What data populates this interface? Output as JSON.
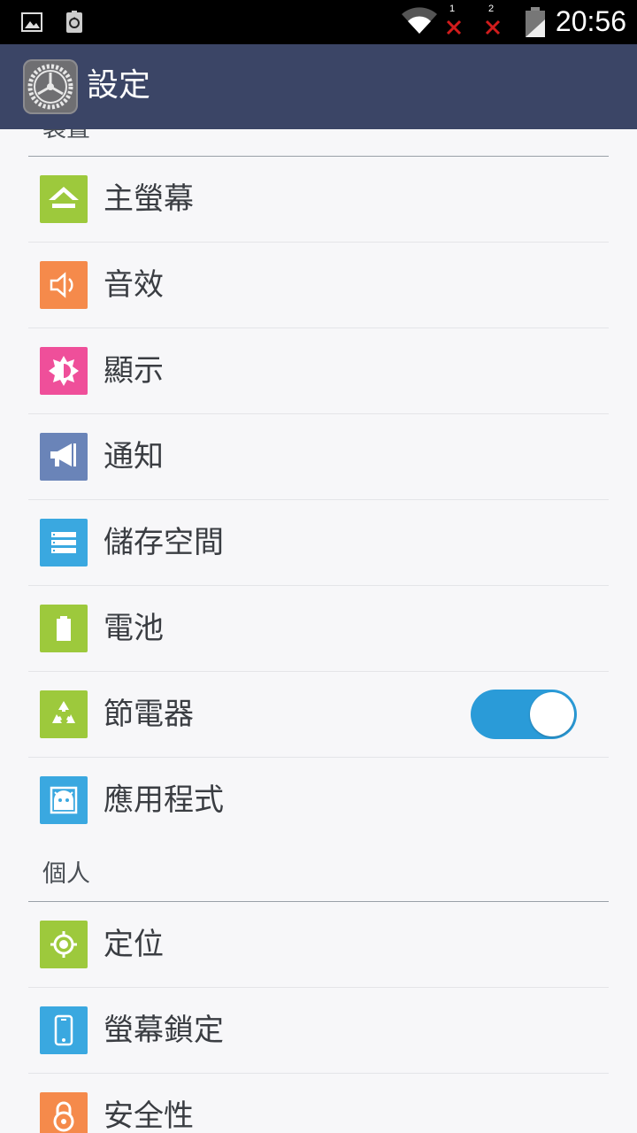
{
  "status_bar": {
    "time": "20:56",
    "sim1_label": "1",
    "sim2_label": "2",
    "icons": [
      "image-icon",
      "recycle-notification-icon",
      "wifi-icon",
      "no-signal-sim1-icon",
      "no-signal-sim2-icon",
      "battery-charging-icon"
    ]
  },
  "app_bar": {
    "title": "設定",
    "icon": "settings-gear-icon"
  },
  "sections": {
    "device": {
      "header": "裝置",
      "items": {
        "home": {
          "label": "主螢幕",
          "icon": "home-icon",
          "color": "#9dc93c"
        },
        "sound": {
          "label": "音效",
          "icon": "speaker-icon",
          "color": "#f58a4b"
        },
        "display": {
          "label": "顯示",
          "icon": "brightness-icon",
          "color": "#ef4f9a"
        },
        "notifications": {
          "label": "通知",
          "icon": "megaphone-icon",
          "color": "#6a84b8"
        },
        "storage": {
          "label": "儲存空間",
          "icon": "storage-icon",
          "color": "#3aa8e0"
        },
        "battery": {
          "label": "電池",
          "icon": "battery-icon",
          "color": "#9dc93c"
        },
        "power_saver": {
          "label": "節電器",
          "icon": "recycle-icon",
          "color": "#9dc93c",
          "toggle": "on"
        },
        "apps": {
          "label": "應用程式",
          "icon": "apps-icon",
          "color": "#3aa8e0"
        }
      }
    },
    "personal": {
      "header": "個人",
      "items": {
        "location": {
          "label": "定位",
          "icon": "location-icon",
          "color": "#9dc93c"
        },
        "screen_lock": {
          "label": "螢幕鎖定",
          "icon": "phone-lock-icon",
          "color": "#3aa8e0"
        },
        "security": {
          "label": "安全性",
          "icon": "lock-icon",
          "color": "#f58a4b"
        }
      }
    }
  },
  "accent_color": "#2a9bd8",
  "app_bar_color": "#3b4566"
}
